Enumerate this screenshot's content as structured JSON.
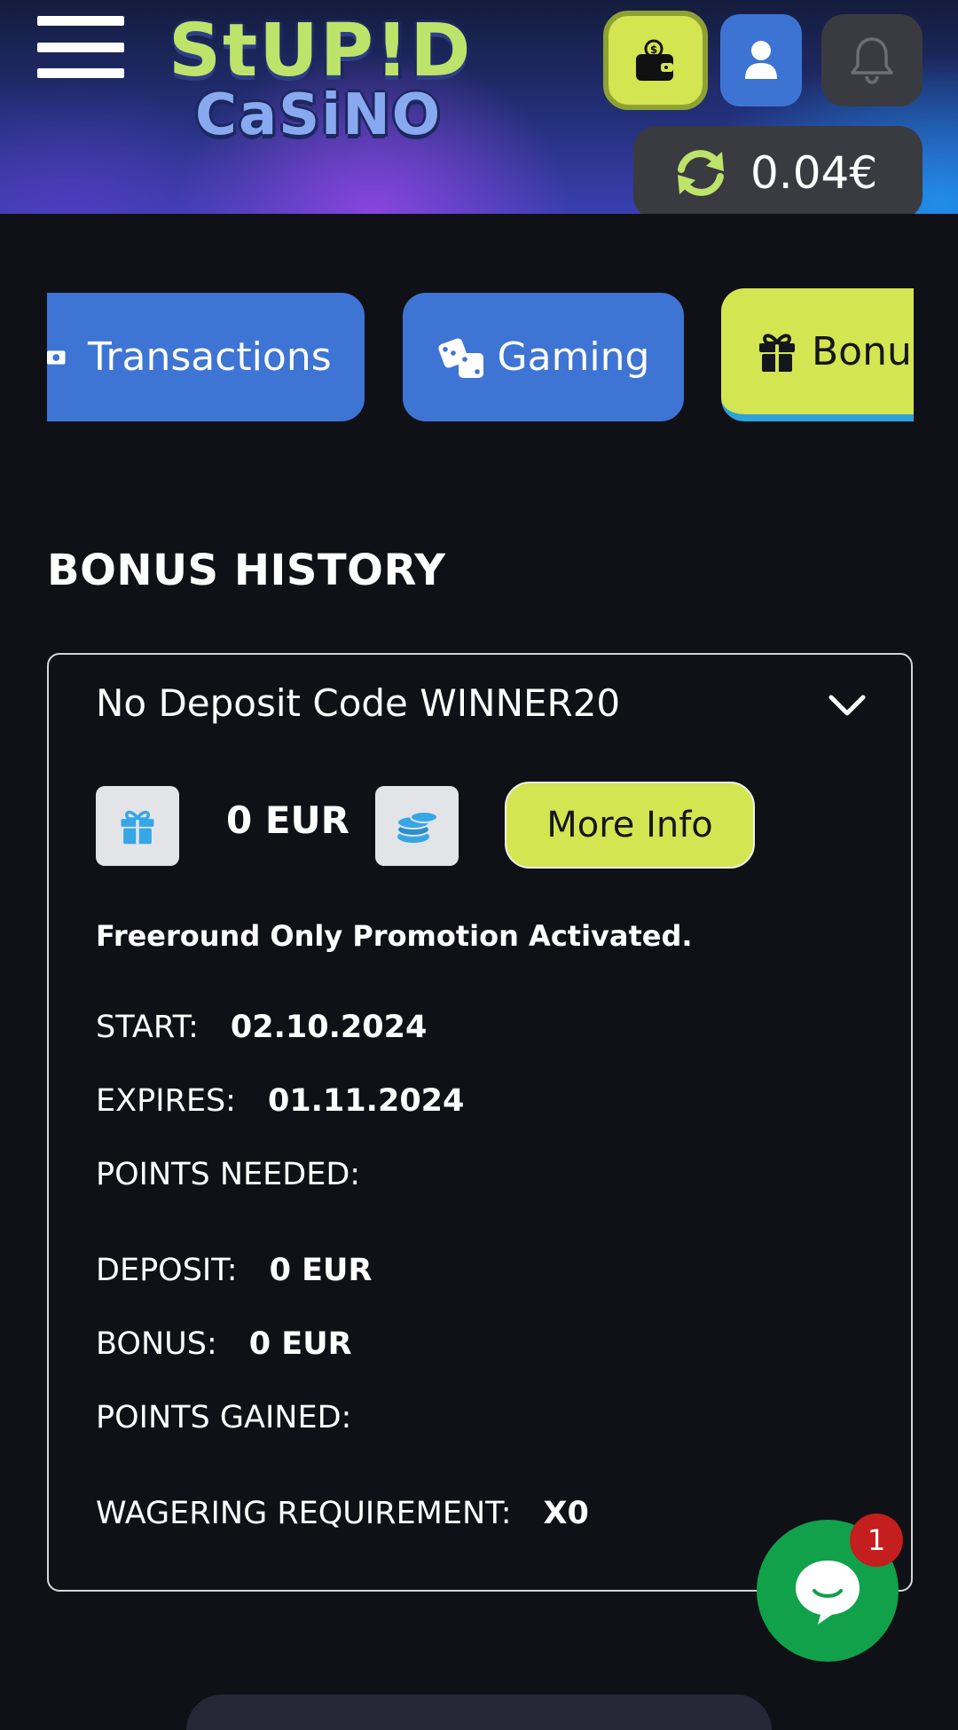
{
  "header": {
    "logo": {
      "line1": "StUP!D",
      "line2": "CaSiNO"
    },
    "balance": "0.04€"
  },
  "tabs": [
    {
      "label": "Transactions"
    },
    {
      "label": "Gaming"
    },
    {
      "label": "Bonus"
    }
  ],
  "section_title": "BONUS HISTORY",
  "bonus_card": {
    "title": "No Deposit Code WINNER20",
    "amount": "0 EUR",
    "more_info_label": "More Info",
    "promo_text": "Freeround Only Promotion Activated.",
    "start_label": "START:",
    "start_value": "02.10.2024",
    "expires_label": "EXPIRES:",
    "expires_value": "01.11.2024",
    "points_needed_label": "POINTS NEEDED:",
    "deposit_label": "DEPOSIT:",
    "deposit_value": "0 EUR",
    "bonus_label": "BONUS:",
    "bonus_value": "0 EUR",
    "points_gained_label": "POINTS GAINED:",
    "wagering_label": "WAGERING REQUIREMENT:",
    "wagering_value": "X0"
  },
  "chat": {
    "badge_count": "1"
  },
  "colors": {
    "accent_lime": "#d3e550",
    "accent_blue": "#3e74d4",
    "background": "#101117",
    "chat_green": "#11a14a",
    "badge_red": "#c41e1e"
  },
  "icons": {
    "menu": "hamburger-menu-icon",
    "wallet": "wallet-icon",
    "user": "user-icon",
    "notifications": "bell-icon",
    "refresh": "refresh-icon",
    "transactions": "money-icon",
    "gaming": "dice-icon",
    "bonus": "gift-icon",
    "expand": "chevron-down-icon",
    "coins": "coins-icon",
    "chat": "chat-bubble-icon"
  }
}
